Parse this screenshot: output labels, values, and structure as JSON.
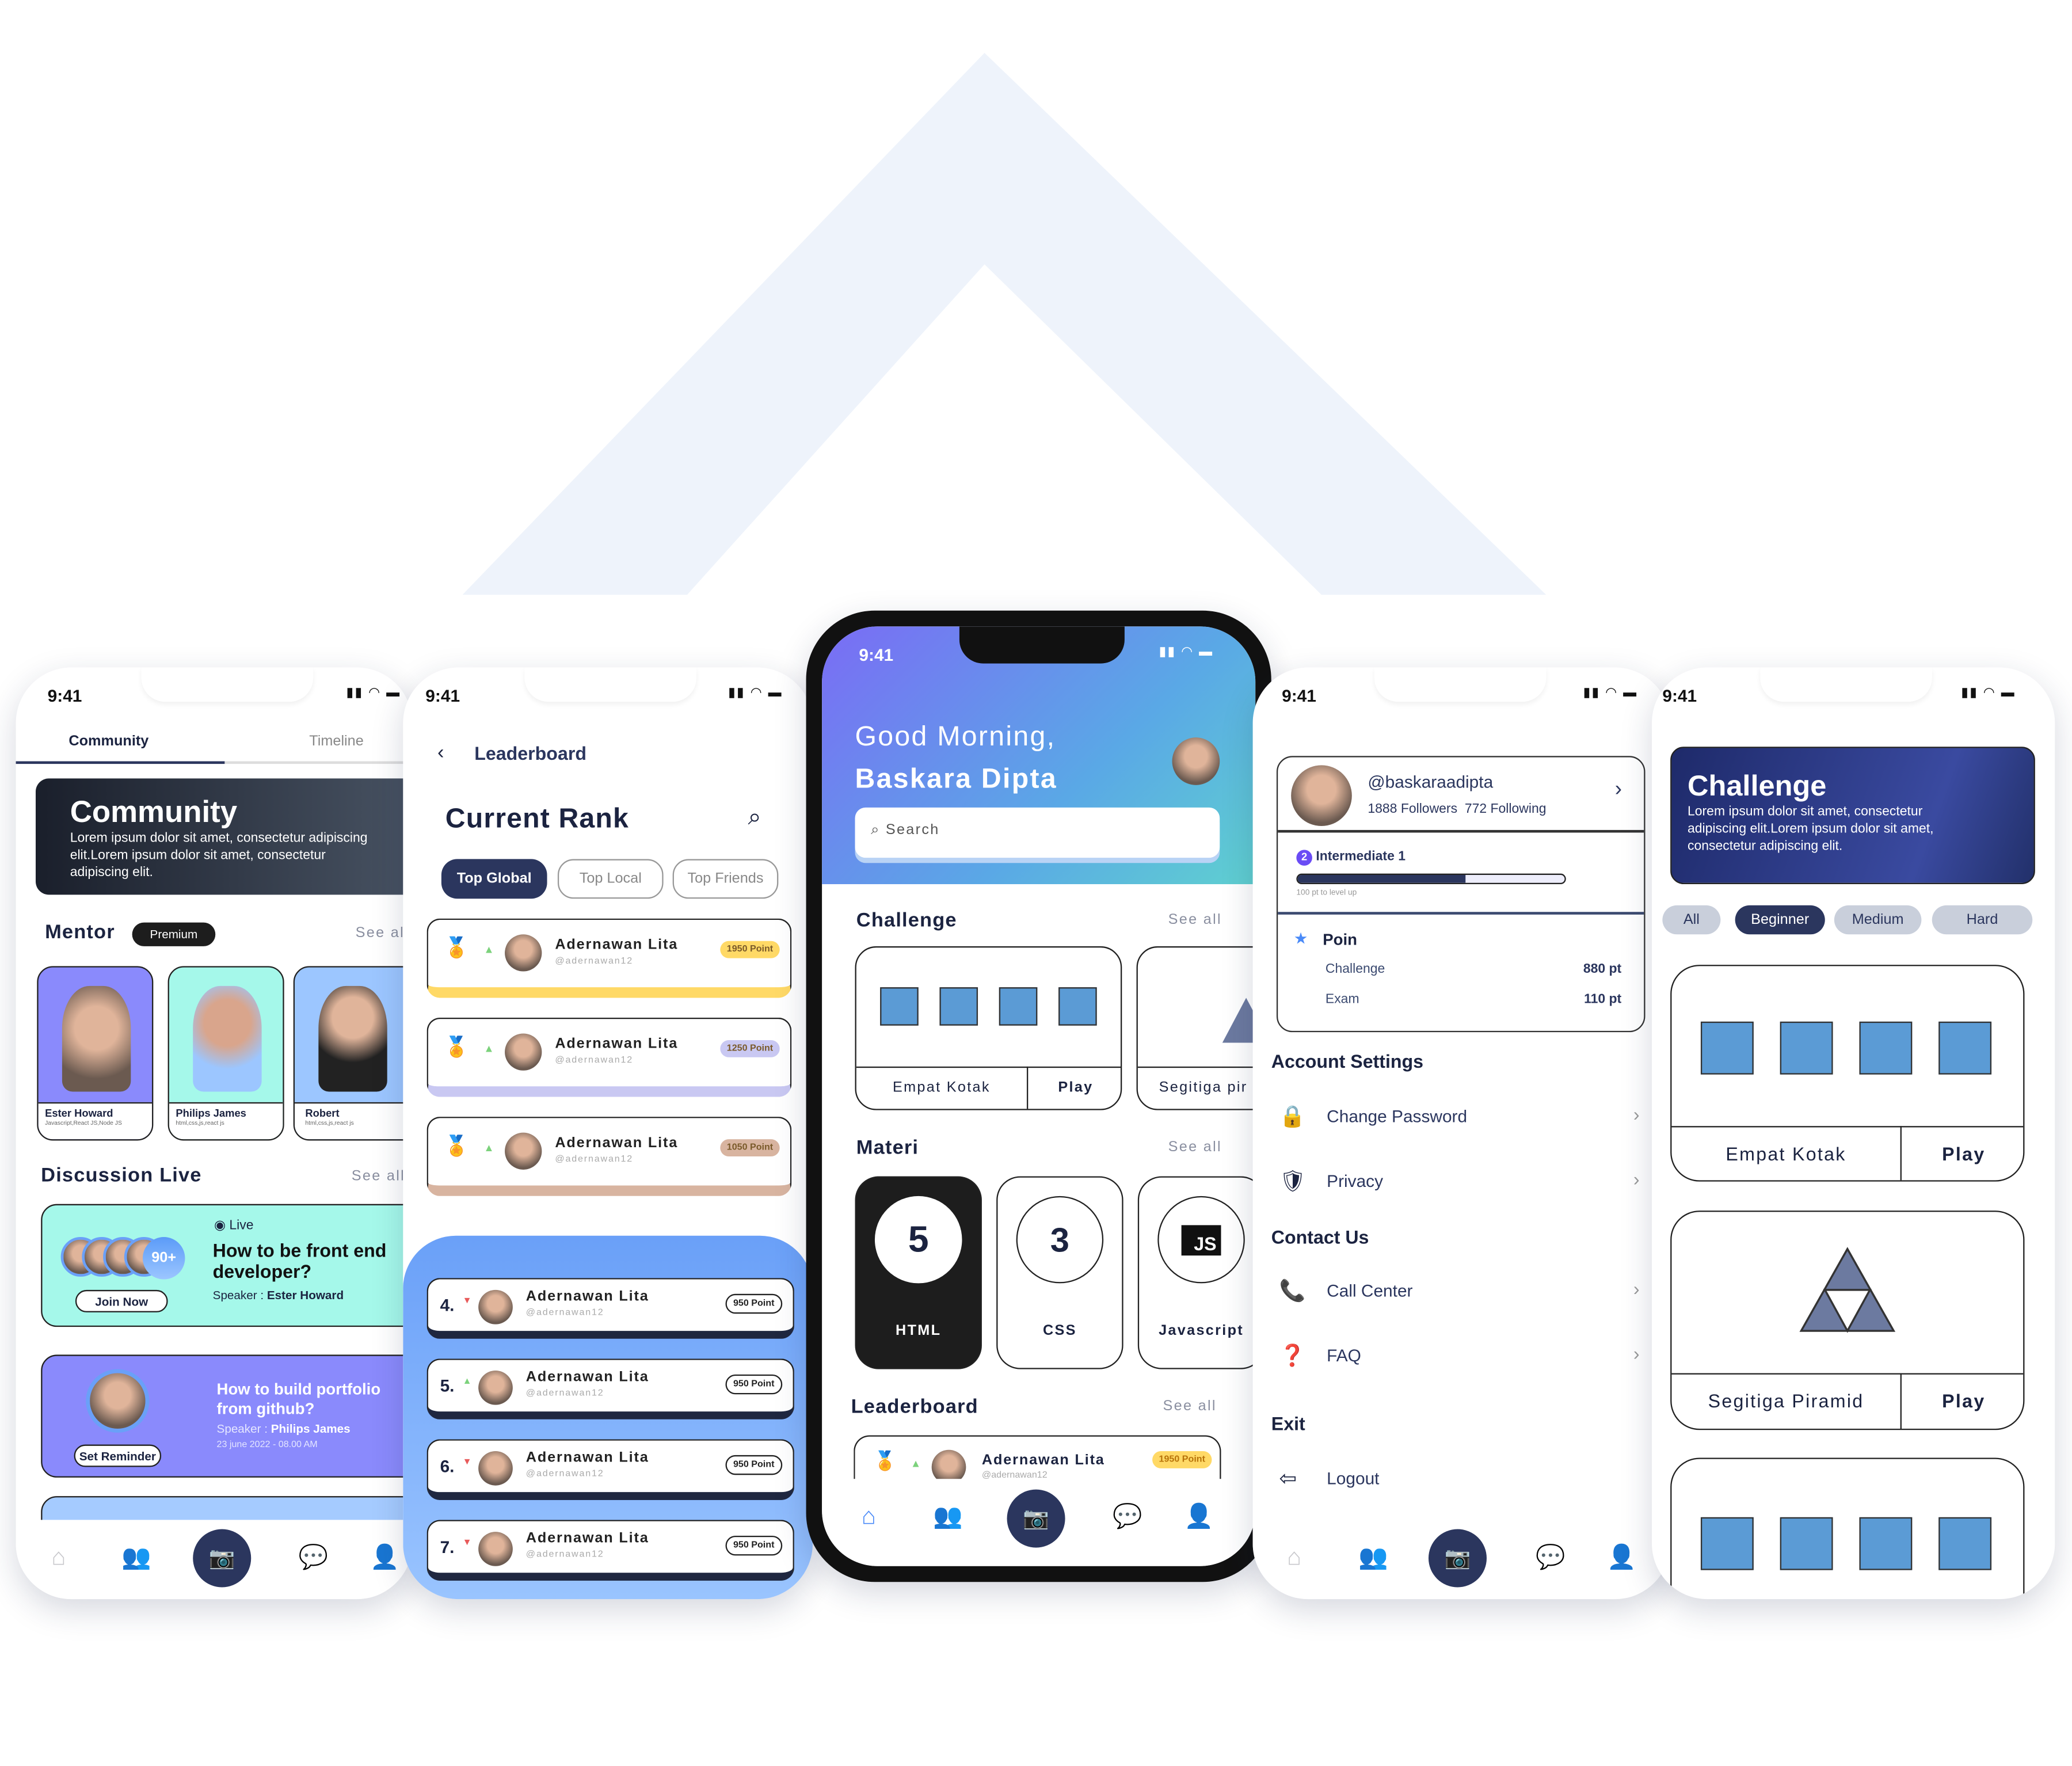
{
  "status_time": "9:41",
  "community": {
    "tabs": [
      "Community",
      "Timeline"
    ],
    "banner": {
      "title": "Community",
      "text": "Lorem ipsum dolor sit amet, consectetur adipiscing elit.Lorem ipsum dolor sit amet, consectetur adipiscing elit."
    },
    "mentor_title": "Mentor",
    "premium": "Premium",
    "see_all": "See all",
    "mentors": [
      {
        "name": "Ester Howard",
        "skills": "Javascript,React JS,Node JS",
        "color": "#8a8afc"
      },
      {
        "name": "Philips James",
        "skills": "html,css,js,react js",
        "color": "#a5f8ea"
      },
      {
        "name": "Robert",
        "skills": "html,css,js,react js",
        "color": "#9cc6ff"
      }
    ],
    "discussion_title": "Discussion Live",
    "live": {
      "badge": "Live",
      "count": "90+",
      "title": "How to be front end developer?",
      "speaker_label": "Speaker : ",
      "speaker": "Ester Howard",
      "button": "Join Now"
    },
    "upcoming": {
      "title": "How to build portfolio from github?",
      "speaker_label": "Speaker : ",
      "speaker": "Philips James",
      "date": "23 june 2022 - 08.00 AM",
      "button": "Set Reminder"
    }
  },
  "leaderboard": {
    "back": "Leaderboard",
    "title": "Current Rank",
    "tabs": [
      "Top Global",
      "Top Local",
      "Top Friends"
    ],
    "top": [
      {
        "name": "Adernawan Lita",
        "handle": "@adernawan12",
        "points": "1950 Point",
        "color": "#ffd966"
      },
      {
        "name": "Adernawan Lita",
        "handle": "@adernawan12",
        "points": "1250 Point",
        "color": "#c9c8f2"
      },
      {
        "name": "Adernawan Lita",
        "handle": "@adernawan12",
        "points": "1050 Point",
        "color": "#d8b4a0"
      }
    ],
    "rest": [
      {
        "rank": "4.",
        "name": "Adernawan Lita",
        "handle": "@adernawan12",
        "points": "950 Point"
      },
      {
        "rank": "5.",
        "name": "Adernawan Lita",
        "handle": "@adernawan12",
        "points": "950 Point"
      },
      {
        "rank": "6.",
        "name": "Adernawan Lita",
        "handle": "@adernawan12",
        "points": "950 Point"
      },
      {
        "rank": "7.",
        "name": "Adernawan Lita",
        "handle": "@adernawan12",
        "points": "950 Point"
      }
    ]
  },
  "home": {
    "greeting": "Good Morning,",
    "name": "Baskara Dipta",
    "search_placeholder": "Search",
    "challenge_title": "Challenge",
    "see_all": "See all",
    "challenges": [
      {
        "name": "Empat Kotak",
        "action": "Play"
      },
      {
        "name": "Segitiga pir"
      }
    ],
    "materi_title": "Materi",
    "materi": [
      {
        "label": "HTML",
        "icon": "html5-icon"
      },
      {
        "label": "CSS",
        "icon": "css3-icon"
      },
      {
        "label": "Javascript",
        "icon": "js-icon",
        "glyph": "JS"
      }
    ],
    "leaderboard_title": "Leaderboard",
    "leader": {
      "name": "Adernawan Lita",
      "handle": "@adernawan12",
      "points": "1950 Point"
    }
  },
  "profile": {
    "handle": "@baskaraadipta",
    "followers": "1888 Followers",
    "following": "772 Following",
    "level_num": "2",
    "level": "Intermediate 1",
    "progress": 0.63,
    "level_hint": "100 pt to level up",
    "points_title": "Poin",
    "points": [
      {
        "label": "Challenge",
        "value": "880 pt"
      },
      {
        "label": "Exam",
        "value": "110 pt"
      }
    ],
    "account_title": "Account Settings",
    "account": [
      "Change Password",
      "Privacy"
    ],
    "contact_title": "Contact Us",
    "contact": [
      "Call Center",
      "FAQ"
    ],
    "exit_title": "Exit",
    "logout": "Logout"
  },
  "challenge": {
    "title": "Challenge",
    "text": "Lorem ipsum dolor sit amet, consectetur adipiscing elit.Lorem ipsum dolor sit amet, consectetur adipiscing elit.",
    "filters": [
      "All",
      "Beginner",
      "Medium",
      "Hard"
    ],
    "active_filter": "Beginner",
    "items": [
      {
        "name": "Empat Kotak",
        "action": "Play"
      },
      {
        "name": "Segitiga Piramid",
        "action": "Play"
      }
    ]
  },
  "colors": {
    "navy": "#2b365e",
    "accent_blue": "#5b9bd5",
    "teal": "#a5f8ea",
    "purple": "#8a8afc"
  }
}
